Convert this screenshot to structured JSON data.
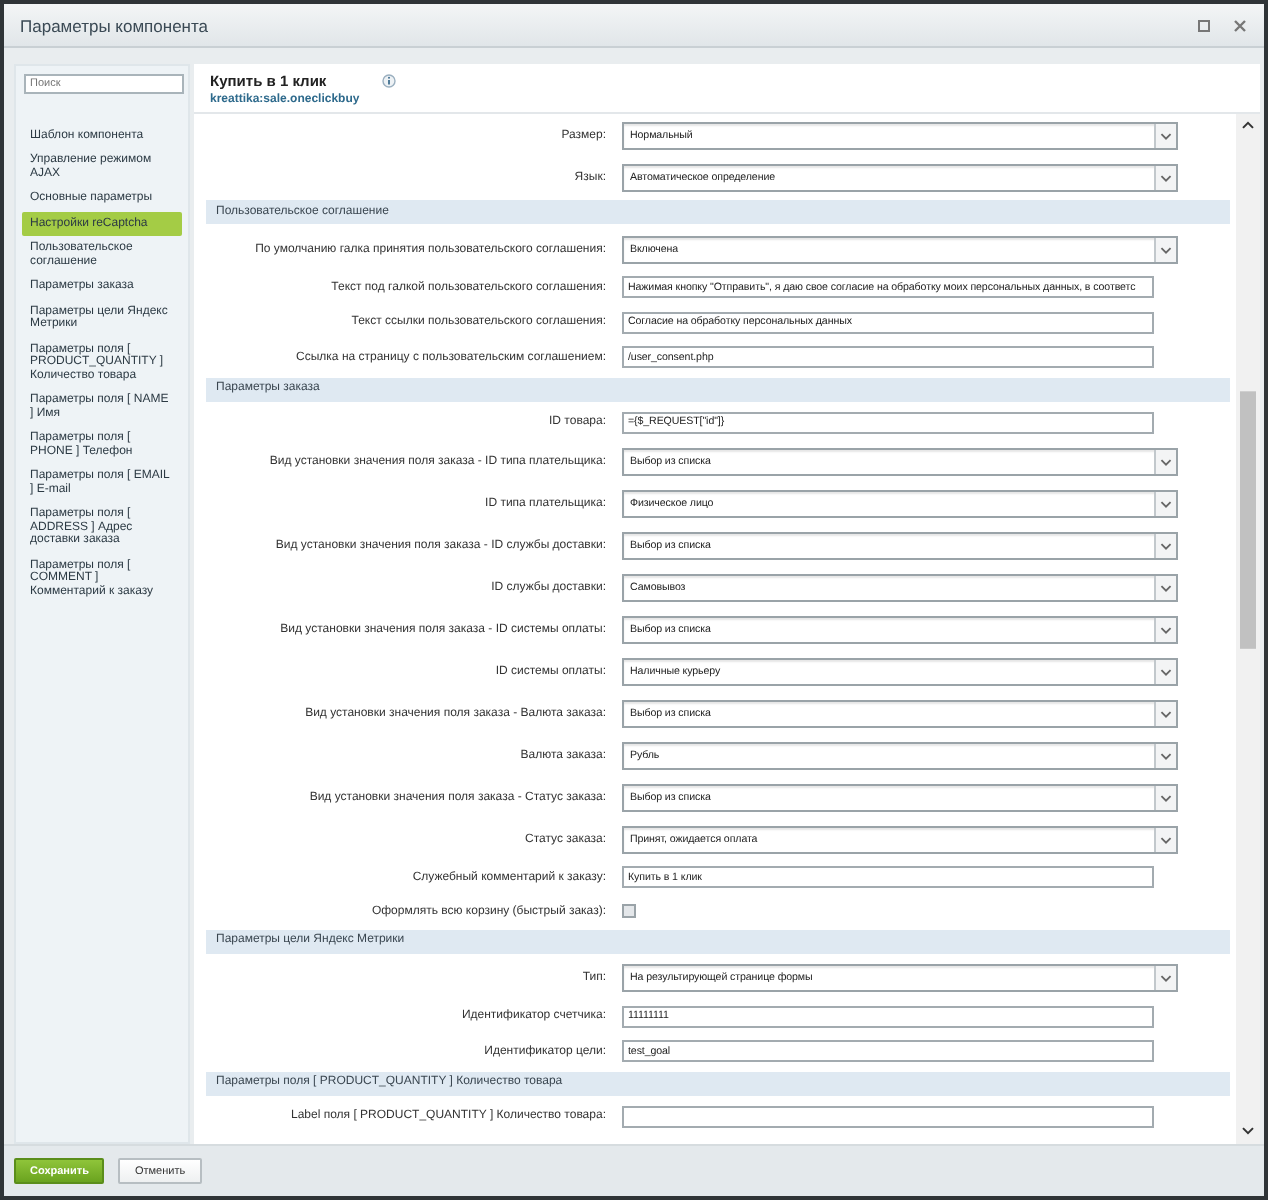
{
  "window": {
    "title": "Параметры компонента"
  },
  "sidebar": {
    "search": {
      "placeholder": "Поиск"
    },
    "items": [
      {
        "label": "Шаблон компонента",
        "selected": false
      },
      {
        "label": "Управление режимом AJAX",
        "selected": false
      },
      {
        "label": "Основные параметры",
        "selected": false
      },
      {
        "label": "Настройки reCaptcha",
        "selected": true
      },
      {
        "label": "Пользовательское соглашение",
        "selected": false
      },
      {
        "label": "Параметры заказа",
        "selected": false
      },
      {
        "label": "Параметры цели Яндекс Метрики",
        "selected": false
      },
      {
        "label": "Параметры поля [ PRODUCT_QUANTITY ] Количество товара",
        "selected": false
      },
      {
        "label": "Параметры поля [ NAME ] Имя",
        "selected": false
      },
      {
        "label": "Параметры поля [ PHONE ] Телефон",
        "selected": false
      },
      {
        "label": "Параметры поля [ EMAIL ] E-mail",
        "selected": false
      },
      {
        "label": "Параметры поля [ ADDRESS ] Адрес доставки заказа",
        "selected": false
      },
      {
        "label": "Параметры поля [ COMMENT ] Комментарий к заказу",
        "selected": false
      }
    ]
  },
  "component": {
    "title": "Купить в 1 клик",
    "code": "kreattika:sale.oneclickbuy"
  },
  "sections": [
    {
      "rows": [
        {
          "kind": "select",
          "label": "Размер:",
          "value": "Нормальный"
        },
        {
          "kind": "select",
          "label": "Язык:",
          "value": "Автоматическое определение"
        }
      ]
    },
    {
      "title": "Пользовательское соглашение",
      "rows": [
        {
          "kind": "select",
          "label": "По умолчанию галка принятия пользовательского соглашения:",
          "value": "Включена"
        },
        {
          "kind": "input",
          "label": "Текст под галкой пользовательского соглашения:",
          "value": "Нажимая кнопку \"Отправить\", я даю свое согласие на обработку моих персональных данных, в соответс"
        },
        {
          "kind": "input",
          "label": "Текст ссылки пользовательского соглашения:",
          "value": "Согласие на обработку персональных данных"
        },
        {
          "kind": "input",
          "label": "Ссылка на страницу с пользовательским соглашением:",
          "value": "/user_consent.php"
        }
      ]
    },
    {
      "title": "Параметры заказа",
      "rows": [
        {
          "kind": "input",
          "label": "ID товара:",
          "value": "={$_REQUEST[\"id\"]}"
        },
        {
          "kind": "select",
          "label": "Вид установки значения поля заказа - ID типа плательщика:",
          "value": "Выбор из списка"
        },
        {
          "kind": "select",
          "label": "ID типа плательщика:",
          "value": "Физическое лицо"
        },
        {
          "kind": "select",
          "label": "Вид установки значения поля заказа - ID службы доставки:",
          "value": "Выбор из списка"
        },
        {
          "kind": "select",
          "label": "ID службы доставки:",
          "value": "Самовывоз"
        },
        {
          "kind": "select",
          "label": "Вид установки значения поля заказа - ID системы оплаты:",
          "value": "Выбор из списка"
        },
        {
          "kind": "select",
          "label": "ID системы оплаты:",
          "value": "Наличные курьеру"
        },
        {
          "kind": "select",
          "label": "Вид установки значения поля заказа - Валюта заказа:",
          "value": "Выбор из списка"
        },
        {
          "kind": "select",
          "label": "Валюта заказа:",
          "value": "Рубль"
        },
        {
          "kind": "select",
          "label": "Вид установки значения поля заказа - Статус заказа:",
          "value": "Выбор из списка"
        },
        {
          "kind": "select",
          "label": "Статус заказа:",
          "value": "Принят, ожидается оплата"
        },
        {
          "kind": "input",
          "label": "Служебный комментарий к заказу:",
          "value": "Купить в 1 клик"
        },
        {
          "kind": "checkbox",
          "label": "Оформлять всю корзину (быстрый заказ):",
          "checked": false
        }
      ]
    },
    {
      "title": "Параметры цели Яндекс Метрики",
      "rows": [
        {
          "kind": "select",
          "label": "Тип:",
          "value": "На результирующей странице формы"
        },
        {
          "kind": "input",
          "label": "Идентификатор счетчика:",
          "value": "11111111"
        },
        {
          "kind": "input",
          "label": "Идентификатор цели:",
          "value": "test_goal"
        }
      ]
    },
    {
      "title": "Параметры поля [ PRODUCT_QUANTITY ] Количество товара",
      "rows": [
        {
          "kind": "input",
          "label": "Label поля [ PRODUCT_QUANTITY ] Количество товара:"
        }
      ]
    }
  ],
  "buttons": [
    {
      "label": "Сохранить",
      "kind": "primary"
    },
    {
      "label": "Отменить",
      "kind": "secondary"
    }
  ]
}
